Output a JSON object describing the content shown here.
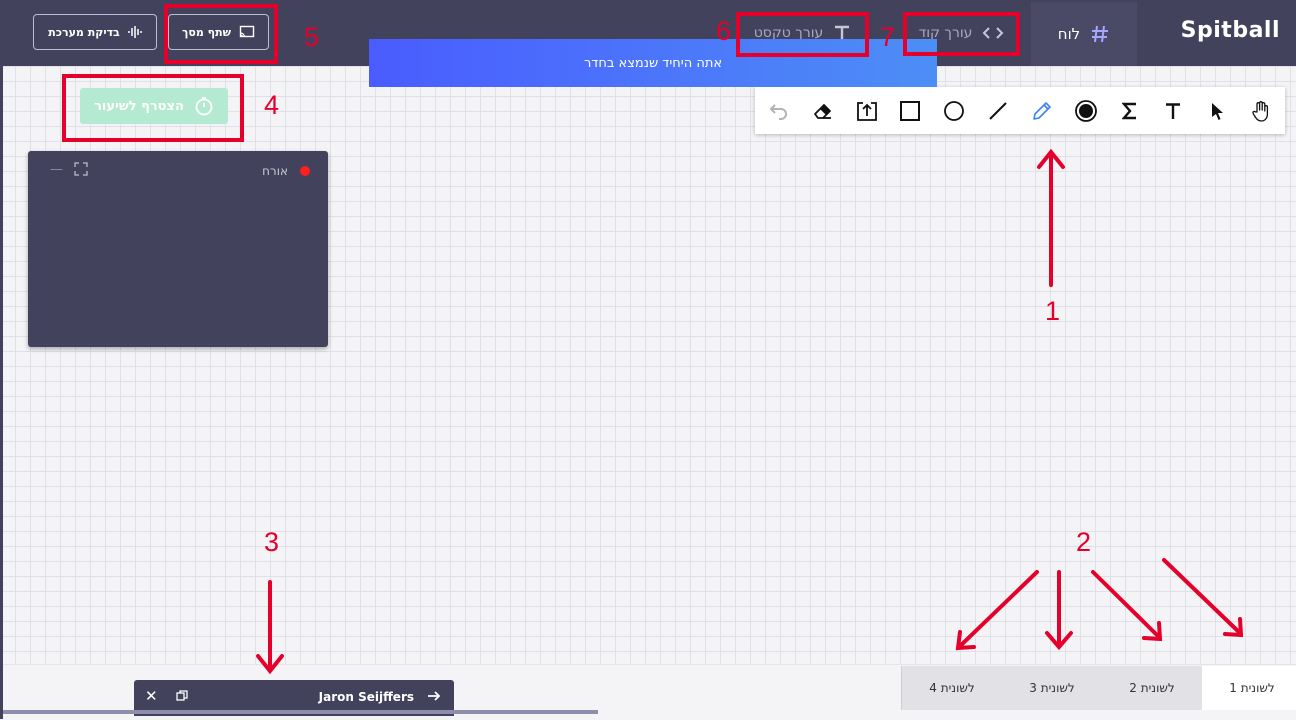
{
  "app": {
    "logo": "Spitball"
  },
  "topbar": {
    "tab_board": "לוח",
    "tab_code": "עורך קוד",
    "tab_text": "עורך טקסט",
    "share_screen": "שתף מסך",
    "system_check": "בדיקת מערכת"
  },
  "notification": {
    "text": "אתה היחיד שנמצא בחדר"
  },
  "toolbar": {
    "tools": [
      "hand-icon",
      "pointer-icon",
      "text-tool-icon",
      "sigma-icon",
      "color-picker-icon",
      "pencil-icon",
      "line-icon",
      "circle-icon",
      "rectangle-icon",
      "upload-icon",
      "eraser-icon",
      "undo-icon"
    ],
    "active_tool": "pencil-icon",
    "active_color": "#3b82f6"
  },
  "join": {
    "label": "הצטרף לשיעור"
  },
  "video": {
    "participant": "אורח",
    "status_color": "#ff1f1f"
  },
  "pages": {
    "tabs": [
      "לשונית 1",
      "לשונית 2",
      "לשונית 3",
      "לשונית 4"
    ],
    "active": 0
  },
  "chat": {
    "name": "Jaron Seijffers"
  },
  "annotations": {
    "labels": [
      "1",
      "2",
      "3",
      "4",
      "5",
      "6",
      "7"
    ],
    "color": "#e4002b"
  },
  "colors": {
    "topbar": "#43425d",
    "notification": "#4a6cf7",
    "join_button": "#b4ead1"
  }
}
